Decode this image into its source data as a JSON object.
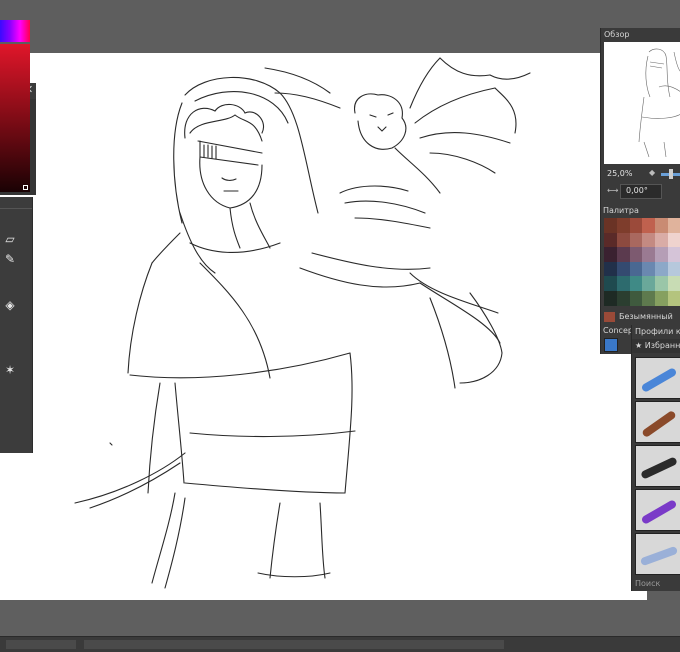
{
  "right_docker": {
    "overview_title": "Обзор",
    "zoom_value": "25,0%",
    "rotation_value": "0,00°",
    "palette_title": "Палитра",
    "palette_name": "Безымянный",
    "palette_set": "Concept-cookie",
    "swatch_colors": [
      "#6a3325",
      "#7e3d2c",
      "#9b4a3a",
      "#c0614e",
      "#c98b73",
      "#e0b39c",
      "#5a2a28",
      "#8c4a3f",
      "#a9685f",
      "#c48a82",
      "#d9aca6",
      "#efd3ce",
      "#3a2130",
      "#5b3a4e",
      "#7d5a70",
      "#9a7a92",
      "#b59eb6",
      "#d5c4d8",
      "#21304a",
      "#344a70",
      "#4a6892",
      "#6a88b0",
      "#8ca8c8",
      "#b6c8dc",
      "#1f4a4f",
      "#2d6b6e",
      "#3f8a86",
      "#6aa89a",
      "#9ac6a8",
      "#c8dcb4",
      "#1e2a24",
      "#2b3e30",
      "#3f5a3e",
      "#5e7a4e",
      "#86a060",
      "#b4c47e"
    ]
  },
  "brush_docker": {
    "title": "Профили ки",
    "favorites_tab": "★ Избранн",
    "search_placeholder": "Поиск"
  },
  "colors": {
    "workspace_bg": "#5e5e5e",
    "canvas_bg": "#ffffff",
    "docker_bg": "#3a3a3a",
    "accent": "#6aa0d8"
  }
}
